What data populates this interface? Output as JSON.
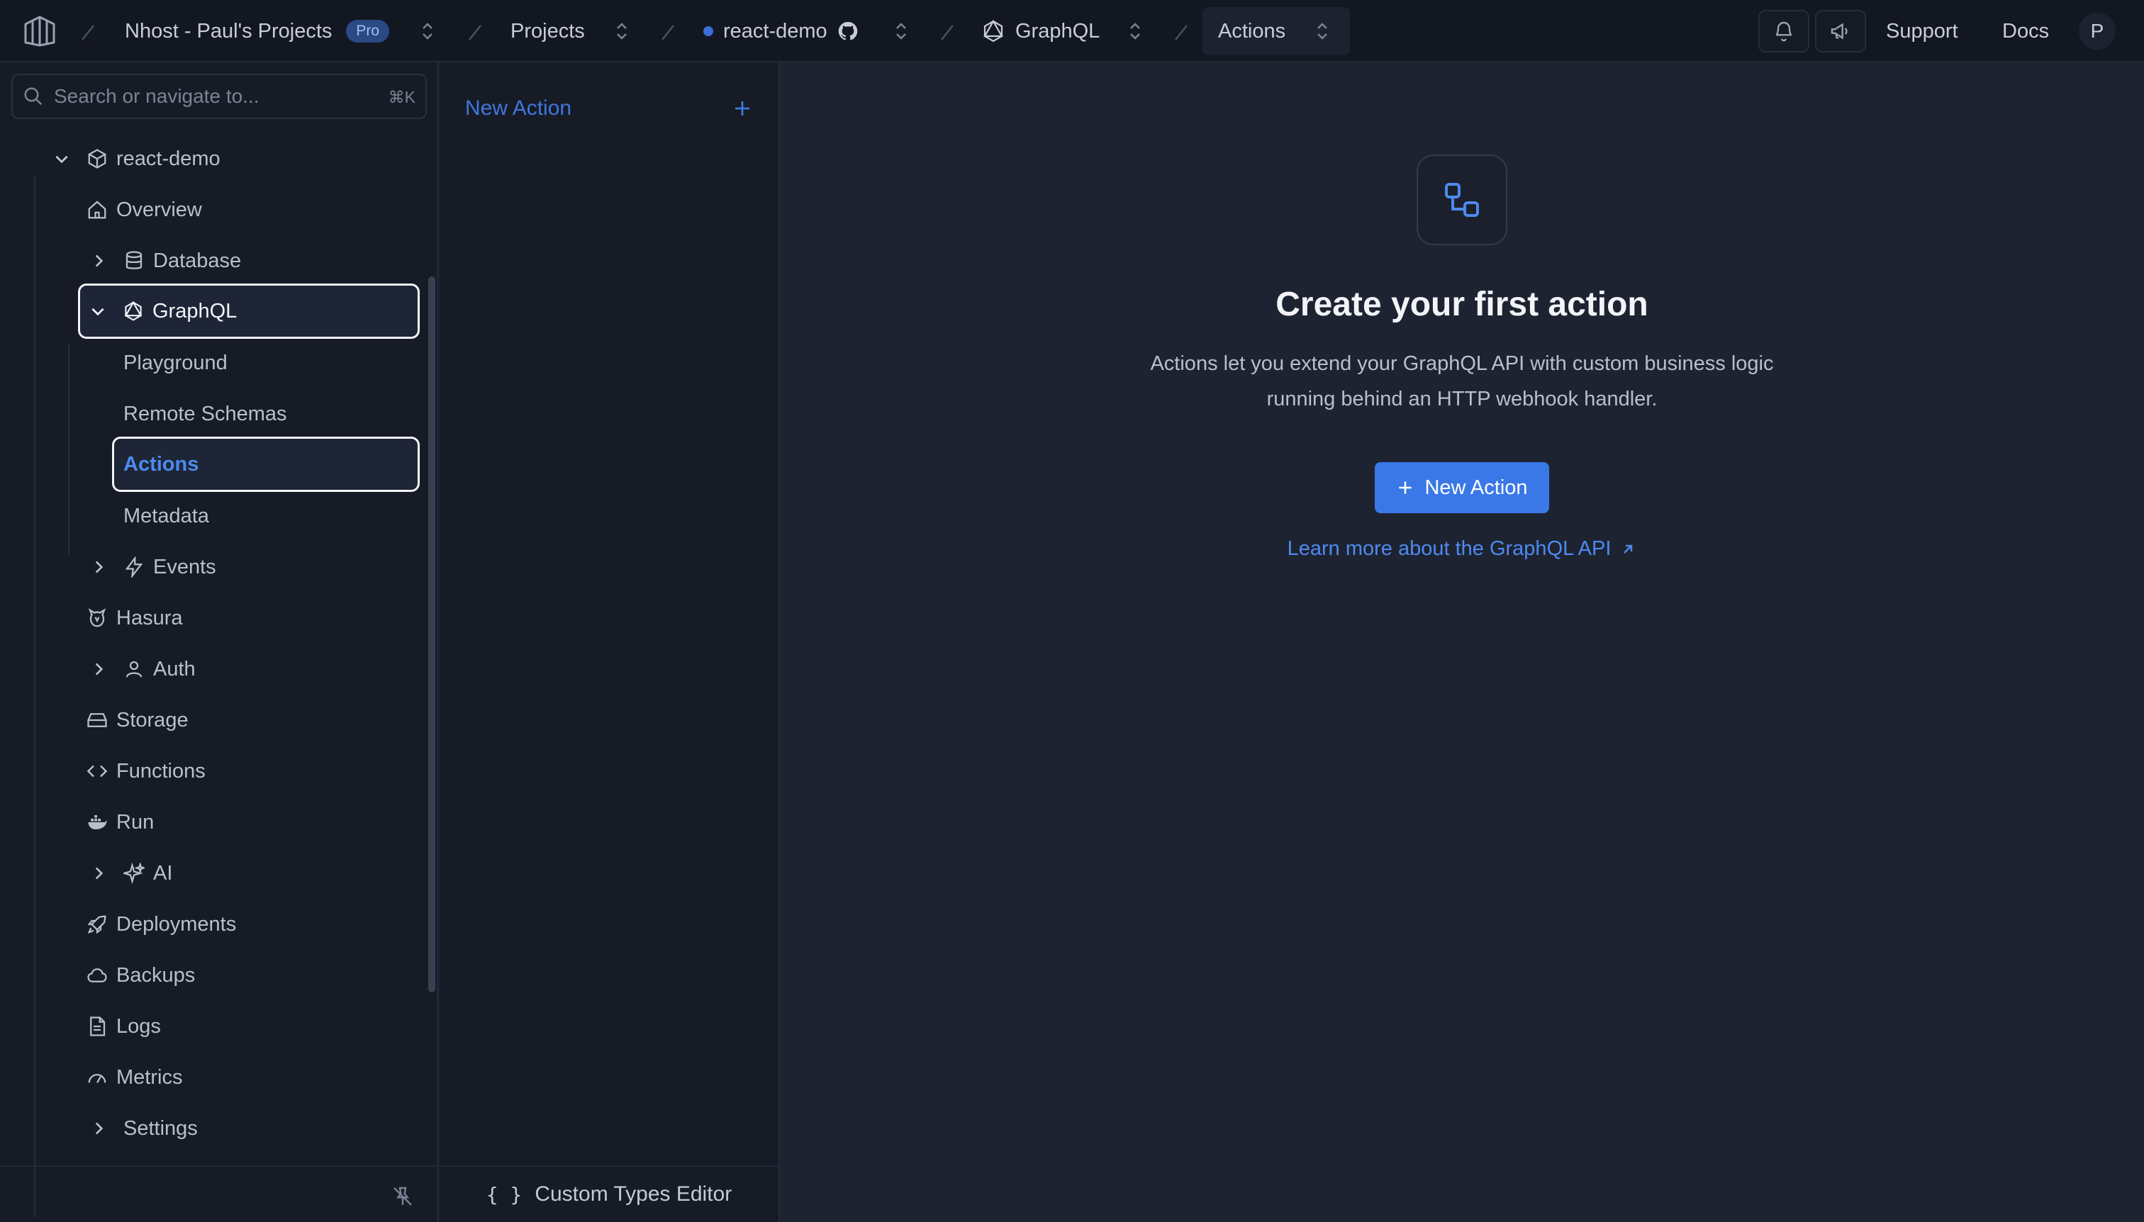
{
  "topbar": {
    "org": "Nhost - Paul's Projects",
    "plan_badge": "Pro",
    "projects": "Projects",
    "project": "react-demo",
    "service": "GraphQL",
    "page": "Actions",
    "support": "Support",
    "docs": "Docs",
    "avatar": "P"
  },
  "sidebar": {
    "search_placeholder": "Search or navigate to...",
    "search_shortcut": "⌘K",
    "project": "react-demo",
    "items": {
      "overview": "Overview",
      "database": "Database",
      "graphql": "GraphQL",
      "playground": "Playground",
      "remote_schemas": "Remote Schemas",
      "actions": "Actions",
      "metadata": "Metadata",
      "events": "Events",
      "hasura": "Hasura",
      "auth": "Auth",
      "storage": "Storage",
      "functions": "Functions",
      "run": "Run",
      "ai": "AI",
      "deployments": "Deployments",
      "backups": "Backups",
      "logs": "Logs",
      "metrics": "Metrics",
      "settings": "Settings"
    }
  },
  "midpanel": {
    "new_action": "New Action",
    "braces": "{ }",
    "custom_types": "Custom Types Editor"
  },
  "empty_state": {
    "title": "Create your first action",
    "description": "Actions let you extend your GraphQL API with custom business logic running behind an HTTP webhook handler.",
    "button": "New Action",
    "learn_more": "Learn more about the GraphQL API"
  },
  "colors": {
    "accent": "#3a78e8",
    "link": "#4d8af0",
    "background": "#1e2331"
  }
}
